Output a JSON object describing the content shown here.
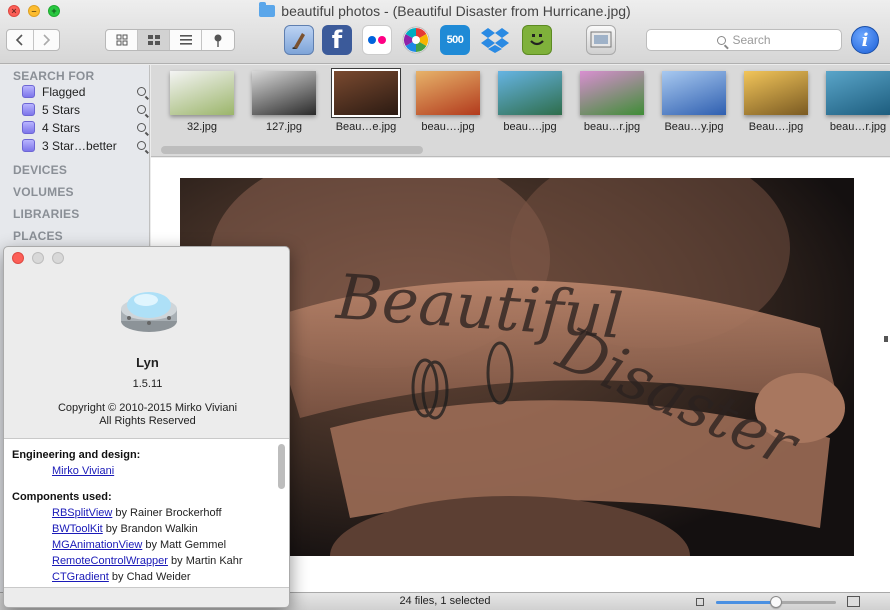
{
  "window": {
    "title": "beautiful photos - (Beautiful Disaster from Hurricane.jpg)"
  },
  "toolbar": {
    "view_modes": [
      "grid-small",
      "grid-large",
      "list",
      "pin"
    ],
    "active_view": "grid-large",
    "services": [
      "edit-icon",
      "facebook-icon",
      "flickr-icon",
      "picasa-icon",
      "500px-icon",
      "dropbox-icon",
      "smugmug-icon",
      "slideshow-icon"
    ],
    "search_placeholder": "Search",
    "info_label": "i"
  },
  "sidebar": {
    "search_for": "SEARCH FOR",
    "searches": [
      {
        "label": "Flagged"
      },
      {
        "label": "5 Stars"
      },
      {
        "label": "4 Stars"
      },
      {
        "label": "3 Star…better"
      }
    ],
    "devices": "DEVICES",
    "volumes": "VOLUMES",
    "libraries": "LIBRARIES",
    "places": "PLACES"
  },
  "thumbnails": [
    {
      "label": "32.jpg",
      "colors": [
        "#f4f4f4",
        "#9bb56a"
      ]
    },
    {
      "label": "127.jpg",
      "colors": [
        "#d8d8d8",
        "#2a2a2a"
      ]
    },
    {
      "label": "Beau…e.jpg",
      "colors": [
        "#7a4a30",
        "#2b1a12"
      ]
    },
    {
      "label": "beau….jpg",
      "colors": [
        "#e7b36a",
        "#b23a1d"
      ]
    },
    {
      "label": "beau….jpg",
      "colors": [
        "#66b4e3",
        "#2e6d4b"
      ]
    },
    {
      "label": "beau…r.jpg",
      "colors": [
        "#d98fd1",
        "#3f8d36"
      ]
    },
    {
      "label": "Beau…y.jpg",
      "colors": [
        "#a8c9f0",
        "#2f5fb0"
      ]
    },
    {
      "label": "Beau….jpg",
      "colors": [
        "#f2c55a",
        "#7a5a22"
      ]
    },
    {
      "label": "beau…r.jpg",
      "colors": [
        "#5aa5c9",
        "#1d5d7e"
      ]
    }
  ],
  "selected_thumbnail": 2,
  "photo": {
    "text_line1": "Beautiful",
    "text_line2": "Disaster"
  },
  "status": {
    "text": "24 files, 1 selected",
    "zoom": 0.5
  },
  "about": {
    "app_name": "Lyn",
    "version": "1.5.11",
    "copyright": "Copyright © 2010-2015 Mirko Viviani",
    "rights": "All Rights Reserved",
    "eng_heading": "Engineering and design:",
    "eng_author": "Mirko Viviani",
    "components_heading": "Components used:",
    "components": [
      {
        "name": "RBSplitView",
        "by": " by Rainer Brockerhoff"
      },
      {
        "name": "BWToolKit",
        "by": " by Brandon Walkin"
      },
      {
        "name": "MGAnimationView",
        "by": " by Matt Gemmel"
      },
      {
        "name": "RemoteControlWrapper",
        "by": " by Martin Kahr"
      },
      {
        "name": "CTGradient",
        "by": " by Chad Weider"
      }
    ]
  }
}
